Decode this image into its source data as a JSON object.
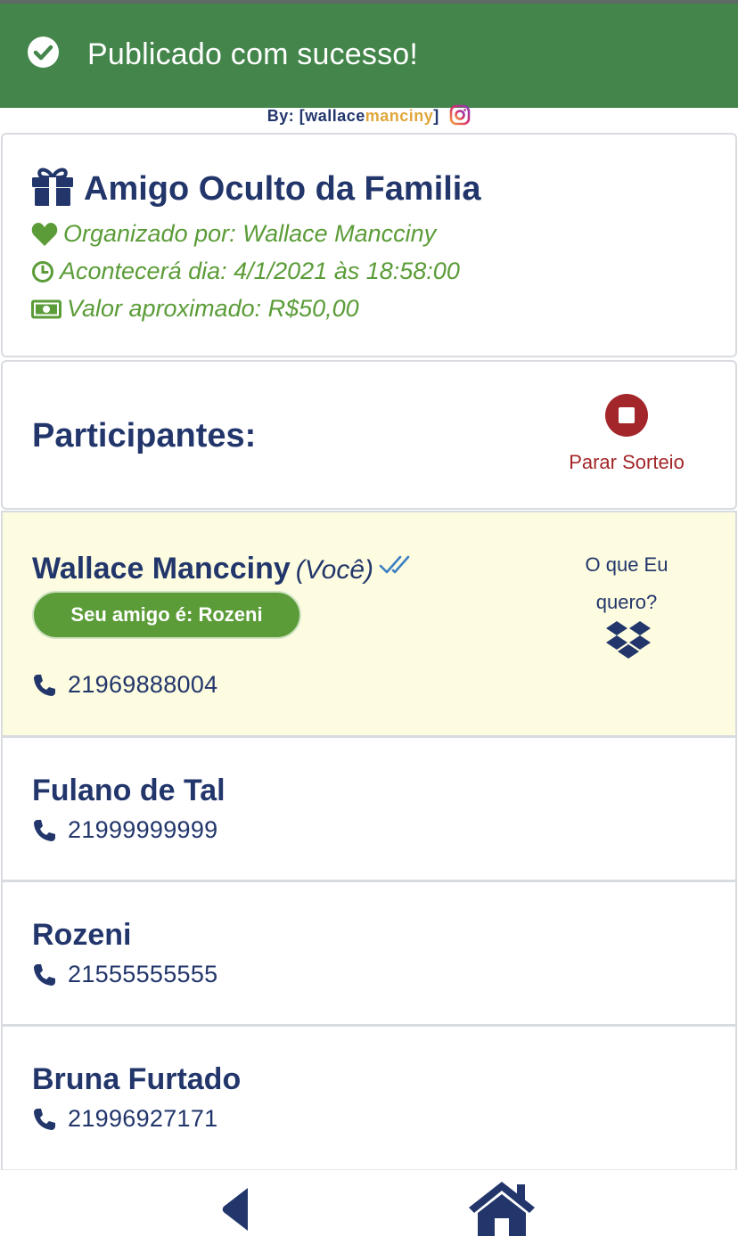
{
  "toast": {
    "message": "Publicado com sucesso!"
  },
  "byline": {
    "prefix": "By: [",
    "part1": "wallace",
    "part2": "manciny",
    "suffix": "]"
  },
  "event": {
    "title": "Amigo Oculto da Familia",
    "organizer": "Organizado por: Wallace Mancciny",
    "date": "Acontecerá dia: 4/1/2021 às 18:58:00",
    "value": "Valor aproximado: R$50,00"
  },
  "participants": {
    "title": "Participantes:",
    "stop_label": "Parar Sorteio",
    "list": [
      {
        "name": "Wallace Mancciny",
        "you_label": "(Você)",
        "friend": "Seu amigo é: Rozeni",
        "phone": "21969888004",
        "want_label": "O que Eu quero?"
      },
      {
        "name": "Fulano de Tal",
        "phone": "21999999999"
      },
      {
        "name": "Rozeni",
        "phone": "21555555555"
      },
      {
        "name": "Bruna Furtado",
        "phone": "21996927171"
      }
    ]
  },
  "icons": {
    "toast": "check-circle-icon",
    "instagram": "instagram-icon",
    "title": "gift-icon",
    "organizer": "heart-icon",
    "date": "clock-icon",
    "value": "money-icon",
    "stop": "stop-icon",
    "seen": "double-check-icon",
    "phone": "phone-icon",
    "wish": "dropbox-icon",
    "back": "back-arrow-icon",
    "home": "home-icon"
  },
  "colors": {
    "toast_bg": "#43854a",
    "primary": "#22366b",
    "accent_green": "#5b9c38",
    "stop_red": "#a3272a",
    "highlight_row": "#fdfce0",
    "byline_gold": "#e0a63a"
  }
}
